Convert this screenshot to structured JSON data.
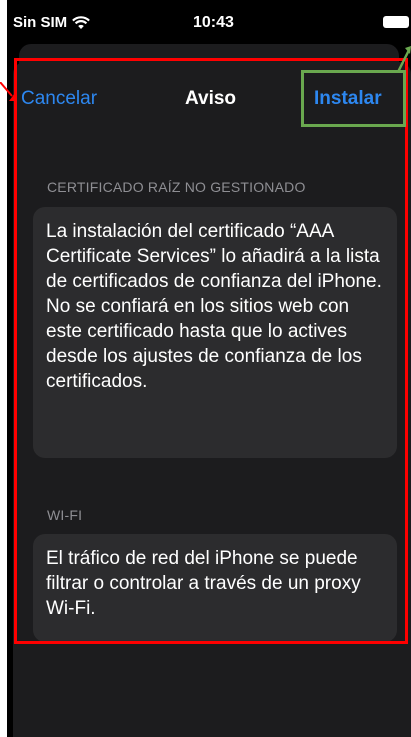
{
  "status_bar": {
    "carrier": "Sin SIM",
    "time": "10:43",
    "icons": [
      "wifi-icon",
      "battery-icon"
    ]
  },
  "nav": {
    "cancel_label": "Cancelar",
    "title": "Aviso",
    "install_label": "Instalar"
  },
  "sections": [
    {
      "header": "CERTIFICADO RAÍZ NO GESTIONADO",
      "body": "La instalación del certificado “AAA Certificate Services” lo añadirá a la lista de certificados de confianza del iPhone. No se confiará en los sitios web con este certificado hasta que lo actives desde los ajustes de confianza de los certificados."
    },
    {
      "header": "WI-FI",
      "body": "El tráfico de red del iPhone se puede filtrar o controlar a través de un proxy Wi-Fi."
    }
  ],
  "colors": {
    "accent": "#2d87f0",
    "annotation_red": "#ff0000",
    "annotation_green": "#6aa84f"
  }
}
